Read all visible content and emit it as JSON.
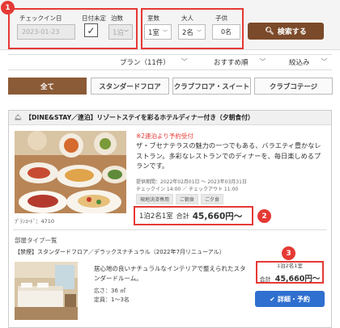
{
  "search": {
    "checkin_label": "チェックイン日",
    "checkin_value": "2023-01-23",
    "undecided_label": "日付未定",
    "nights_label": "泊数",
    "nights_value": "1泊",
    "rooms_label": "室数",
    "rooms_value": "1室",
    "adults_label": "大人",
    "adults_value": "2名",
    "children_label": "子供",
    "children_value": "0名",
    "search_button": "検索する",
    "badge1": "1"
  },
  "sortbar": {
    "plan_count": "プラン（11件）",
    "recommended": "おすすめ順",
    "filter": "絞込み"
  },
  "tabs": [
    "全て",
    "スタンダードフロア",
    "クラブフロア・スイート",
    "クラブコテージ"
  ],
  "plan": {
    "title": "【DINE&STAY／連泊】リゾートステイを彩るホテルディナー付き（夕朝食付）",
    "notice": "※2連泊より予約受付",
    "description": "ザ・ブセナテラスの魅力の一つでもある、バラエティ豊かなレストラン。多彩なレストランでのディナーを、毎日楽しめるプランです。",
    "period": "提供期間：2022年02月01日 ～ 2023年03月31日",
    "checkin_out": "チェックイン 14:00 ／ チェックアウト 11:00",
    "tags": [
      "現地決済専用",
      "ご朝食",
      "ご夕食"
    ],
    "plan_code": "ﾌﾟﾗﾝｺｰﾄﾞ：4710",
    "price_summary": "1泊2名1室",
    "price_prefix": "合計",
    "price": "45,660円～",
    "badge2": "2"
  },
  "room": {
    "section_label": "部屋タイプ一覧",
    "title": "【禁煙】スタンダードフロア／デラックスナチュラル（2022年7月リニューアル）",
    "description": "居心地の良いナチュラルなインテリアで整えられたスタンダードルーム。",
    "size": "広さ：36 ㎡",
    "capacity": "定員：1～3名",
    "price_summary": "1泊2名1室",
    "price_prefix": "合計",
    "price": "45,660円〜",
    "detail_button": "詳細・予約",
    "badge3": "3"
  }
}
